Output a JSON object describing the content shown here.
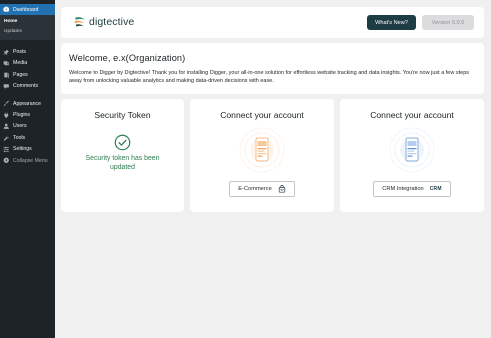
{
  "sidebar": {
    "dashboard": {
      "label": "Dashboard",
      "icon": "dashboard-icon"
    },
    "submenu": [
      {
        "label": "Home"
      },
      {
        "label": "Updates"
      }
    ],
    "items": [
      {
        "label": "Posts",
        "icon": "pin-icon"
      },
      {
        "label": "Media",
        "icon": "media-icon"
      },
      {
        "label": "Pages",
        "icon": "pages-icon"
      },
      {
        "label": "Comments",
        "icon": "comment-icon"
      },
      {
        "label": "Appearance",
        "icon": "brush-icon"
      },
      {
        "label": "Plugins",
        "icon": "plugin-icon"
      },
      {
        "label": "Users",
        "icon": "user-icon"
      },
      {
        "label": "Tools",
        "icon": "wrench-icon"
      },
      {
        "label": "Settings",
        "icon": "settings-icon"
      },
      {
        "label": "Collapse Menu",
        "icon": "collapse-icon"
      }
    ]
  },
  "header": {
    "brand": "digtective",
    "whats_new": "What's New?",
    "version": "Version 0.0.0"
  },
  "welcome": {
    "title": "Welcome, e.x(Organization)",
    "body": "Welcome to Digger by Digtective! Thank you for installing Digger, your all-in-one solution for effortless website tracking and data insights. You're now just a few steps away from unlocking valuable analytics and making data-driven decisions with ease."
  },
  "tiles": {
    "token": {
      "title": "Security Token",
      "message": "Security token has been updated"
    },
    "ecommerce": {
      "title": "Connect your account",
      "button": "E-Commerce"
    },
    "crm": {
      "title": "Connect your account",
      "button": "CRM Integration",
      "badge": "CRM"
    }
  },
  "colors": {
    "sidebar_bg": "#1d2327",
    "sidebar_active": "#2271b1",
    "brand_dark": "#1d3c44",
    "success": "#2e7d4f",
    "ecommerce_accent": "#f0a35e",
    "crm_accent": "#5b8fd6"
  }
}
